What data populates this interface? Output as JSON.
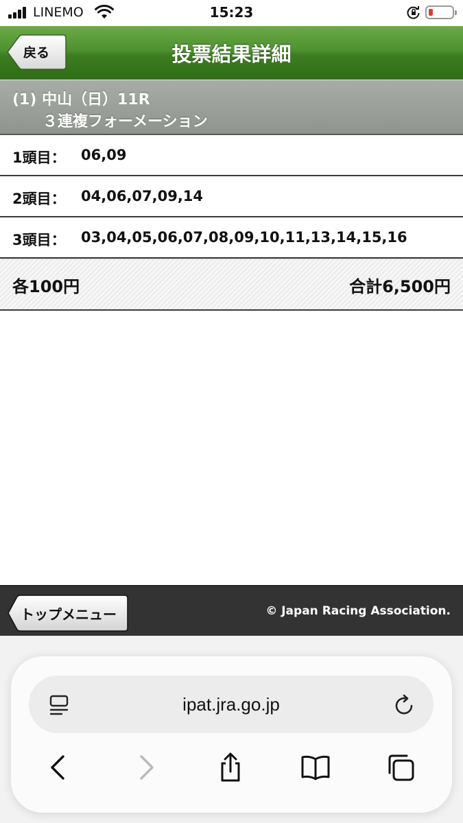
{
  "status_bar": {
    "carrier": "LINEMO",
    "time": "15:23"
  },
  "header": {
    "title": "投票結果詳細",
    "back_label": "戻る",
    "color": "#3d7d21"
  },
  "race": {
    "line1": "(1) 中山（日）11R",
    "line2": "３連複フォーメーション"
  },
  "rows": [
    {
      "label": "1頭目：",
      "value": "06,09"
    },
    {
      "label": "2頭目：",
      "value": "04,06,07,09,14"
    },
    {
      "label": "3頭目：",
      "value": "03,04,05,06,07,08,09,10,11,13,14,15,16"
    }
  ],
  "totals": {
    "each": "各100円",
    "sum": "合計6,500円"
  },
  "footer": {
    "top_menu_label": "トップメニュー",
    "copyright": "© Japan Racing Association."
  },
  "browser": {
    "url": "ipat.jra.go.jp",
    "icons": [
      "reader-icon",
      "reload-icon",
      "back-icon",
      "forward-icon",
      "share-icon",
      "bookmarks-icon",
      "tabs-icon"
    ]
  }
}
